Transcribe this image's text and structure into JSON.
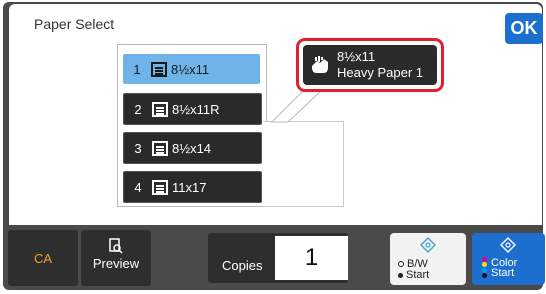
{
  "header": {
    "title": "Paper Select",
    "ok_label": "OK"
  },
  "trays": [
    {
      "number": "1",
      "size": "8½x11",
      "selected": true
    },
    {
      "number": "2",
      "size": "8½x11R",
      "selected": false
    },
    {
      "number": "3",
      "size": "8½x14",
      "selected": false
    },
    {
      "number": "4",
      "size": "11x17",
      "selected": false
    }
  ],
  "bypass": {
    "size": "8½x11",
    "type": "Heavy Paper 1",
    "icon": "hand-tray-icon"
  },
  "bottom": {
    "ca_label": "CA",
    "preview_label": "Preview",
    "copies_label": "Copies",
    "copies_value": "1",
    "bw_start_line1": "B/W",
    "bw_start_line2": "Start",
    "color_start_line1": "Color",
    "color_start_line2": "Start"
  },
  "colors": {
    "accent_blue": "#1d6fcf",
    "selected_tray": "#6fb4e9",
    "highlight_red": "#e0202b",
    "ca_orange": "#f0a020"
  }
}
